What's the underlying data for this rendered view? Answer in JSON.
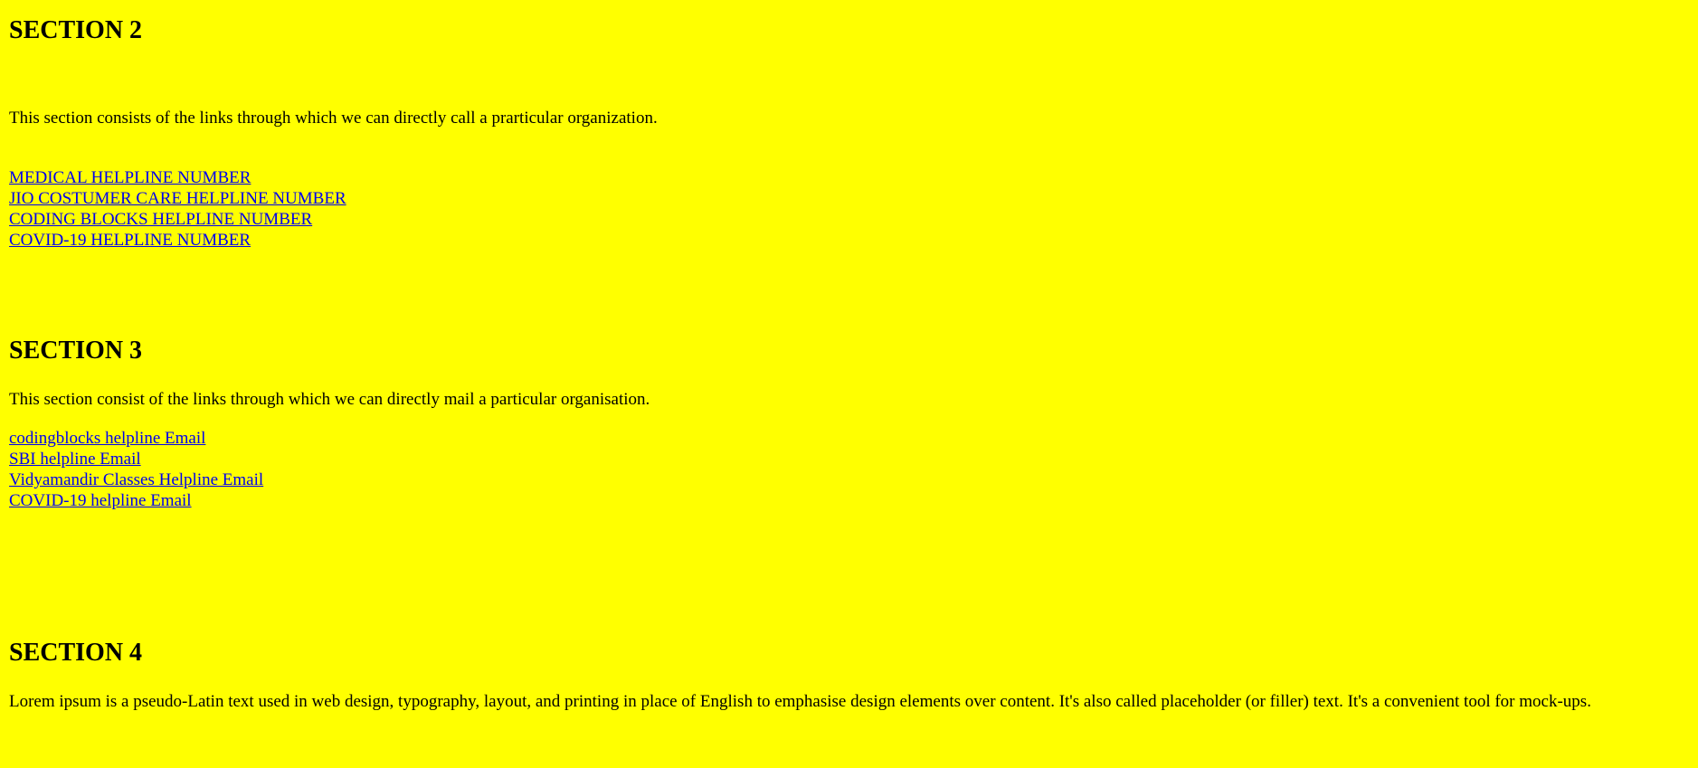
{
  "section2": {
    "heading": "SECTION 2",
    "description": "This section consists of the links through which we can directly call a prarticular organization.",
    "links": [
      {
        "label": "MEDICAL HELPLINE NUMBER"
      },
      {
        "label": "JIO COSTUMER CARE HELPLINE NUMBER"
      },
      {
        "label": "CODING BLOCKS HELPLINE NUMBER"
      },
      {
        "label": "COVID-19 HELPLINE NUMBER"
      }
    ]
  },
  "section3": {
    "heading": "SECTION 3",
    "description": "This section consist of the links through which we can directly mail a particular organisation.",
    "links": [
      {
        "label": "codingblocks helpline Email"
      },
      {
        "label": "SBI helpline Email"
      },
      {
        "label": "Vidyamandir Classes Helpline Email"
      },
      {
        "label": "COVID-19 helpline Email"
      }
    ]
  },
  "section4": {
    "heading": "SECTION 4",
    "description": "Lorem ipsum is a pseudo-Latin text used in web design, typography, layout, and printing in place of English to emphasise design elements over content. It's also called placeholder (or filler) text. It's a convenient tool for mock-ups."
  },
  "colors": {
    "background": "#ffff00",
    "link": "#0000ee",
    "text": "#000000"
  }
}
